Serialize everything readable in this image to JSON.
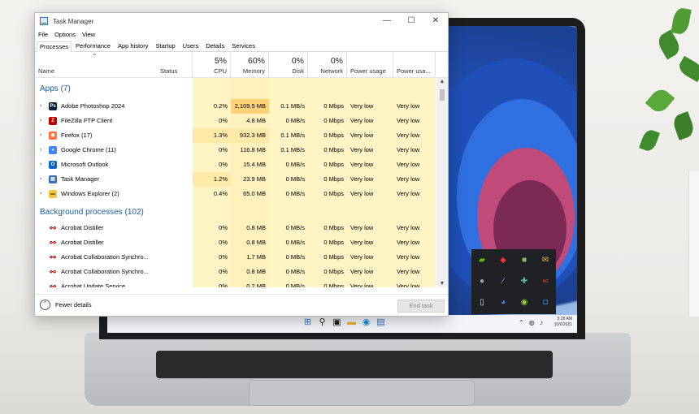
{
  "window": {
    "title": "Task Manager",
    "minimize_glyph": "—",
    "maximize_glyph": "☐",
    "close_glyph": "✕"
  },
  "menu": [
    "File",
    "Options",
    "View"
  ],
  "tabs": [
    "Processes",
    "Performance",
    "App history",
    "Startup",
    "Users",
    "Details",
    "Services"
  ],
  "header": {
    "name": "Name",
    "status": "Status",
    "cpu": {
      "pct": "5%",
      "label": "CPU"
    },
    "memory": {
      "pct": "60%",
      "label": "Memory"
    },
    "disk": {
      "pct": "0%",
      "label": "Disk"
    },
    "network": {
      "pct": "0%",
      "label": "Network"
    },
    "power": "Power usage",
    "power_trend": "Power usa..."
  },
  "apps_group": "Apps (7)",
  "apps": [
    {
      "name": "Adobe Photoshop 2024",
      "cpu": "0.2%",
      "memory": "2,109.5 MB",
      "disk": "0.1 MB/s",
      "network": "0 Mbps",
      "power": "Very low",
      "power_trend": "Very low",
      "icon": "photoshop-icon",
      "icon_text": "Ps",
      "icon_color": "#001e36"
    },
    {
      "name": "FileZilla FTP Client",
      "cpu": "0%",
      "memory": "4.8 MB",
      "disk": "0 MB/s",
      "network": "0 Mbps",
      "power": "Very low",
      "power_trend": "Very low",
      "icon": "filezilla-icon",
      "icon_text": "Z",
      "icon_color": "#bf0000"
    },
    {
      "name": "Firefox (17)",
      "cpu": "1.3%",
      "memory": "932.3 MB",
      "disk": "0.1 MB/s",
      "network": "0 Mbps",
      "power": "Very low",
      "power_trend": "Very low",
      "icon": "firefox-icon",
      "icon_text": "",
      "icon_color": "#ff7139"
    },
    {
      "name": "Google Chrome (11)",
      "cpu": "0%",
      "memory": "116.8 MB",
      "disk": "0.1 MB/s",
      "network": "0 Mbps",
      "power": "Very low",
      "power_trend": "Very low",
      "icon": "chrome-icon",
      "icon_text": "",
      "icon_color": "#4285f4"
    },
    {
      "name": "Microsoft Outlook",
      "cpu": "0%",
      "memory": "15.4 MB",
      "disk": "0 MB/s",
      "network": "0 Mbps",
      "power": "Very low",
      "power_trend": "Very low",
      "icon": "outlook-icon",
      "icon_text": "O",
      "icon_color": "#0a64c8"
    },
    {
      "name": "Task Manager",
      "cpu": "1.2%",
      "memory": "23.9 MB",
      "disk": "0 MB/s",
      "network": "0 Mbps",
      "power": "Very low",
      "power_trend": "Very low",
      "icon": "task-manager-icon",
      "icon_text": "",
      "icon_color": "#3a6fb5"
    },
    {
      "name": "Windows Explorer (2)",
      "cpu": "0.4%",
      "memory": "65.0 MB",
      "disk": "0 MB/s",
      "network": "0 Mbps",
      "power": "Very low",
      "power_trend": "Very low",
      "icon": "explorer-icon",
      "icon_text": "",
      "icon_color": "#f4c542"
    }
  ],
  "bg_group": "Background processes (102)",
  "background": [
    {
      "name": "Acrobat  Distiller",
      "cpu": "0%",
      "memory": "0.8 MB",
      "disk": "0 MB/s",
      "network": "0 Mbps",
      "power": "Very low",
      "power_trend": "Very low",
      "icon": "acrobat-icon"
    },
    {
      "name": "Acrobat  Distiller",
      "cpu": "0%",
      "memory": "0.8 MB",
      "disk": "0 MB/s",
      "network": "0 Mbps",
      "power": "Very low",
      "power_trend": "Very low",
      "icon": "acrobat-icon"
    },
    {
      "name": "Acrobat Collaboration Synchro...",
      "cpu": "0%",
      "memory": "1.7 MB",
      "disk": "0 MB/s",
      "network": "0 Mbps",
      "power": "Very low",
      "power_trend": "Very low",
      "icon": "acrobat-icon"
    },
    {
      "name": "Acrobat Collaboration Synchro...",
      "cpu": "0%",
      "memory": "0.8 MB",
      "disk": "0 MB/s",
      "network": "0 Mbps",
      "power": "Very low",
      "power_trend": "Very low",
      "icon": "acrobat-icon"
    },
    {
      "name": "Acrobat Update Service",
      "cpu": "0%",
      "memory": "0.2 MB",
      "disk": "0 MB/s",
      "network": "0 Mbps",
      "power": "Very low",
      "power_trend": "Very low",
      "icon": "acrobat-icon"
    }
  ],
  "footer": {
    "fewer_details": "Fewer details",
    "end_task": "End task"
  },
  "taskbar": {
    "time": "5:28 AM",
    "date": "10/6/2021"
  },
  "colors": {
    "heat_light": "#fff4c4",
    "heat_medium": "#ffe9a8",
    "heat_strong": "#ffd27a",
    "group_blue": "#1f5fa6"
  }
}
